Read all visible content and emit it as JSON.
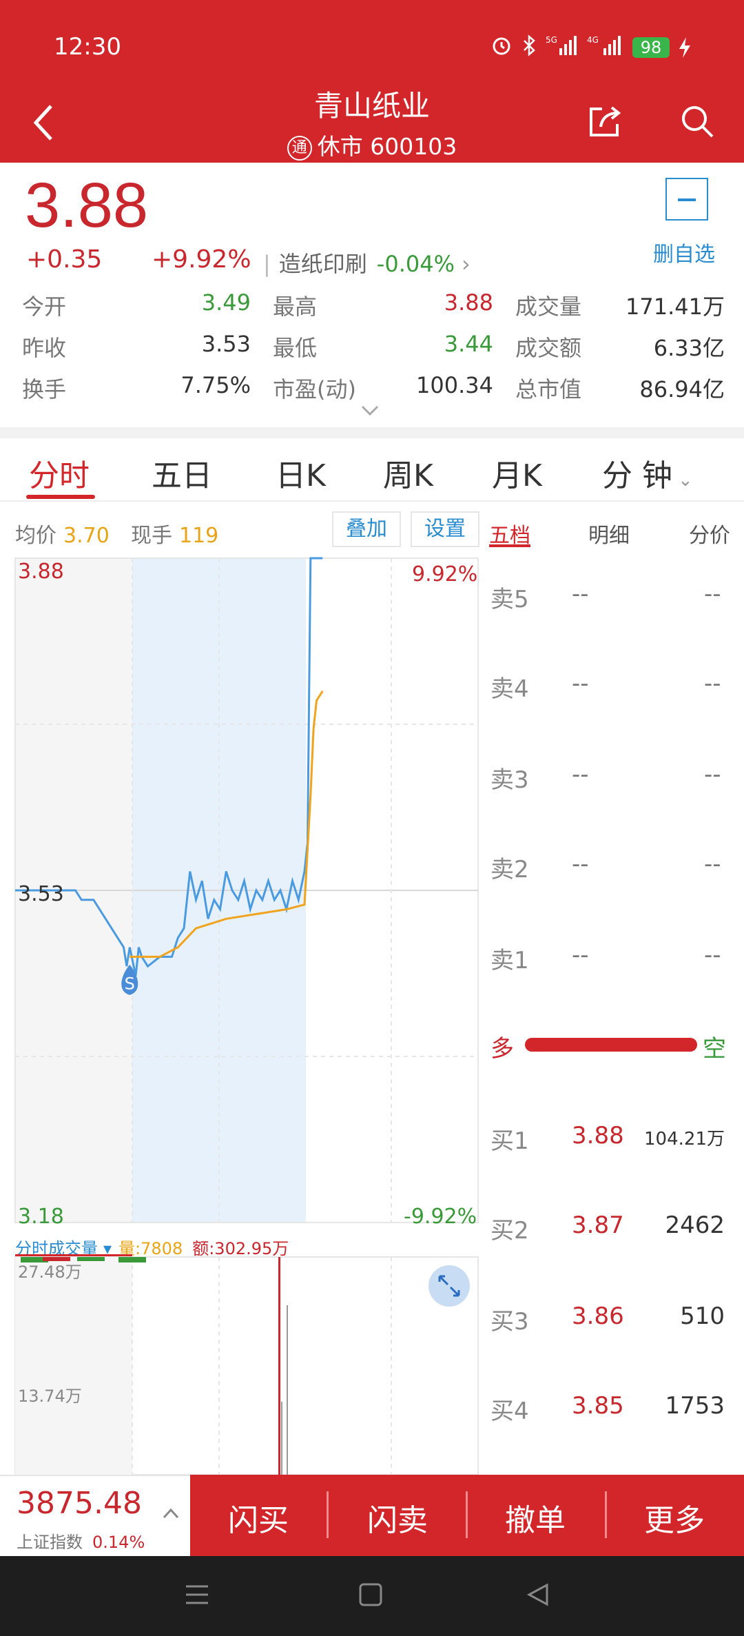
{
  "status_bar": {
    "time": "12:30",
    "battery": "98",
    "net1": "5G",
    "net2": "4G"
  },
  "header": {
    "title": "青山纸业",
    "badge": "通",
    "subtitle": "休市 600103"
  },
  "quote": {
    "price": "3.88",
    "change": "+0.35",
    "change_pct": "+9.92%",
    "sector_name": "造纸印刷",
    "sector_pct": "-0.04%",
    "watch_label": "删自选",
    "stats": [
      {
        "label": "今开",
        "value": "3.49"
      },
      {
        "label": "最高",
        "value": "3.88"
      },
      {
        "label": "成交量",
        "value": "171.41万"
      },
      {
        "label": "昨收",
        "value": "3.53"
      },
      {
        "label": "最低",
        "value": "3.44"
      },
      {
        "label": "成交额",
        "value": "6.33亿"
      },
      {
        "label": "换手",
        "value": "7.75%"
      },
      {
        "label": "市盈(动)",
        "value": "100.34"
      },
      {
        "label": "总市值",
        "value": "86.94亿"
      }
    ]
  },
  "tabs": [
    "分时",
    "五日",
    "日K",
    "周K",
    "月K",
    "分 钟"
  ],
  "chart_info": {
    "avg_label": "均价",
    "avg_value": "3.70",
    "cur_label": "现手",
    "cur_value": "119",
    "overlay_btn": "叠加",
    "settings_btn": "设置"
  },
  "orderbook_tabs": [
    "五档",
    "明细",
    "分价"
  ],
  "chart_data": {
    "type": "line",
    "y_ticks_left": [
      "3.88",
      "3.53",
      "3.18"
    ],
    "y_ticks_right": [
      "9.92%",
      "-9.92%"
    ],
    "ylim": [
      3.18,
      3.88
    ],
    "series": [
      {
        "name": "",
        "color": "#4a9ae0",
        "points": [
          [
            0,
            3.53
          ],
          [
            10,
            3.53
          ],
          [
            11,
            3.52
          ],
          [
            13,
            3.52
          ],
          [
            14,
            3.51
          ],
          [
            15,
            3.5
          ],
          [
            16,
            3.49
          ],
          [
            17,
            3.48
          ],
          [
            18,
            3.47
          ],
          [
            18.5,
            3.45
          ],
          [
            19,
            3.47
          ],
          [
            20,
            3.44
          ],
          [
            20.5,
            3.47
          ],
          [
            21,
            3.46
          ],
          [
            22,
            3.45
          ],
          [
            24,
            3.46
          ],
          [
            26,
            3.46
          ],
          [
            27,
            3.48
          ],
          [
            28,
            3.49
          ],
          [
            29,
            3.55
          ],
          [
            30,
            3.52
          ],
          [
            31,
            3.54
          ],
          [
            32,
            3.5
          ],
          [
            33,
            3.52
          ],
          [
            34,
            3.51
          ],
          [
            35,
            3.55
          ],
          [
            36,
            3.53
          ],
          [
            37,
            3.52
          ],
          [
            38,
            3.54
          ],
          [
            39,
            3.51
          ],
          [
            40,
            3.53
          ],
          [
            41,
            3.52
          ],
          [
            42,
            3.54
          ],
          [
            43,
            3.52
          ],
          [
            44,
            3.53
          ],
          [
            45,
            3.51
          ],
          [
            46,
            3.54
          ],
          [
            47,
            3.52
          ],
          [
            48,
            3.55
          ],
          [
            48.5,
            3.58
          ],
          [
            49,
            3.88
          ],
          [
            51,
            3.88
          ]
        ]
      },
      {
        "name": "",
        "color": "#f0a31c",
        "points": [
          [
            19,
            3.46
          ],
          [
            21,
            3.46
          ],
          [
            24,
            3.46
          ],
          [
            27,
            3.47
          ],
          [
            30,
            3.49
          ],
          [
            35,
            3.5
          ],
          [
            40,
            3.505
          ],
          [
            45,
            3.51
          ],
          [
            48,
            3.515
          ],
          [
            49,
            3.63
          ],
          [
            49.5,
            3.7
          ],
          [
            50,
            3.73
          ],
          [
            51,
            3.74
          ]
        ]
      }
    ],
    "marker": "S"
  },
  "orderbook": {
    "sells": [
      {
        "label": "卖5",
        "price": "--",
        "vol": "--"
      },
      {
        "label": "卖4",
        "price": "--",
        "vol": "--"
      },
      {
        "label": "卖3",
        "price": "--",
        "vol": "--"
      },
      {
        "label": "卖2",
        "price": "--",
        "vol": "--"
      },
      {
        "label": "卖1",
        "price": "--",
        "vol": "--"
      }
    ],
    "bull_label": "多",
    "bear_label": "空",
    "bull_ratio": 1.0,
    "buys": [
      {
        "label": "买1",
        "price": "3.88",
        "vol": "104.21万"
      },
      {
        "label": "买2",
        "price": "3.87",
        "vol": "2462"
      },
      {
        "label": "买3",
        "price": "3.86",
        "vol": "510"
      },
      {
        "label": "买4",
        "price": "3.85",
        "vol": "1753"
      }
    ]
  },
  "volume": {
    "title": "分时成交量",
    "qty_label": "量:7808",
    "amount_label": "额:302.95万",
    "y_top": "27.48万",
    "y_mid": "13.74万"
  },
  "index_box": {
    "value": "3875.48",
    "name": "上证指数",
    "pct": "0.14%"
  },
  "actions": [
    "闪买",
    "闪卖",
    "撤单",
    "更多"
  ]
}
